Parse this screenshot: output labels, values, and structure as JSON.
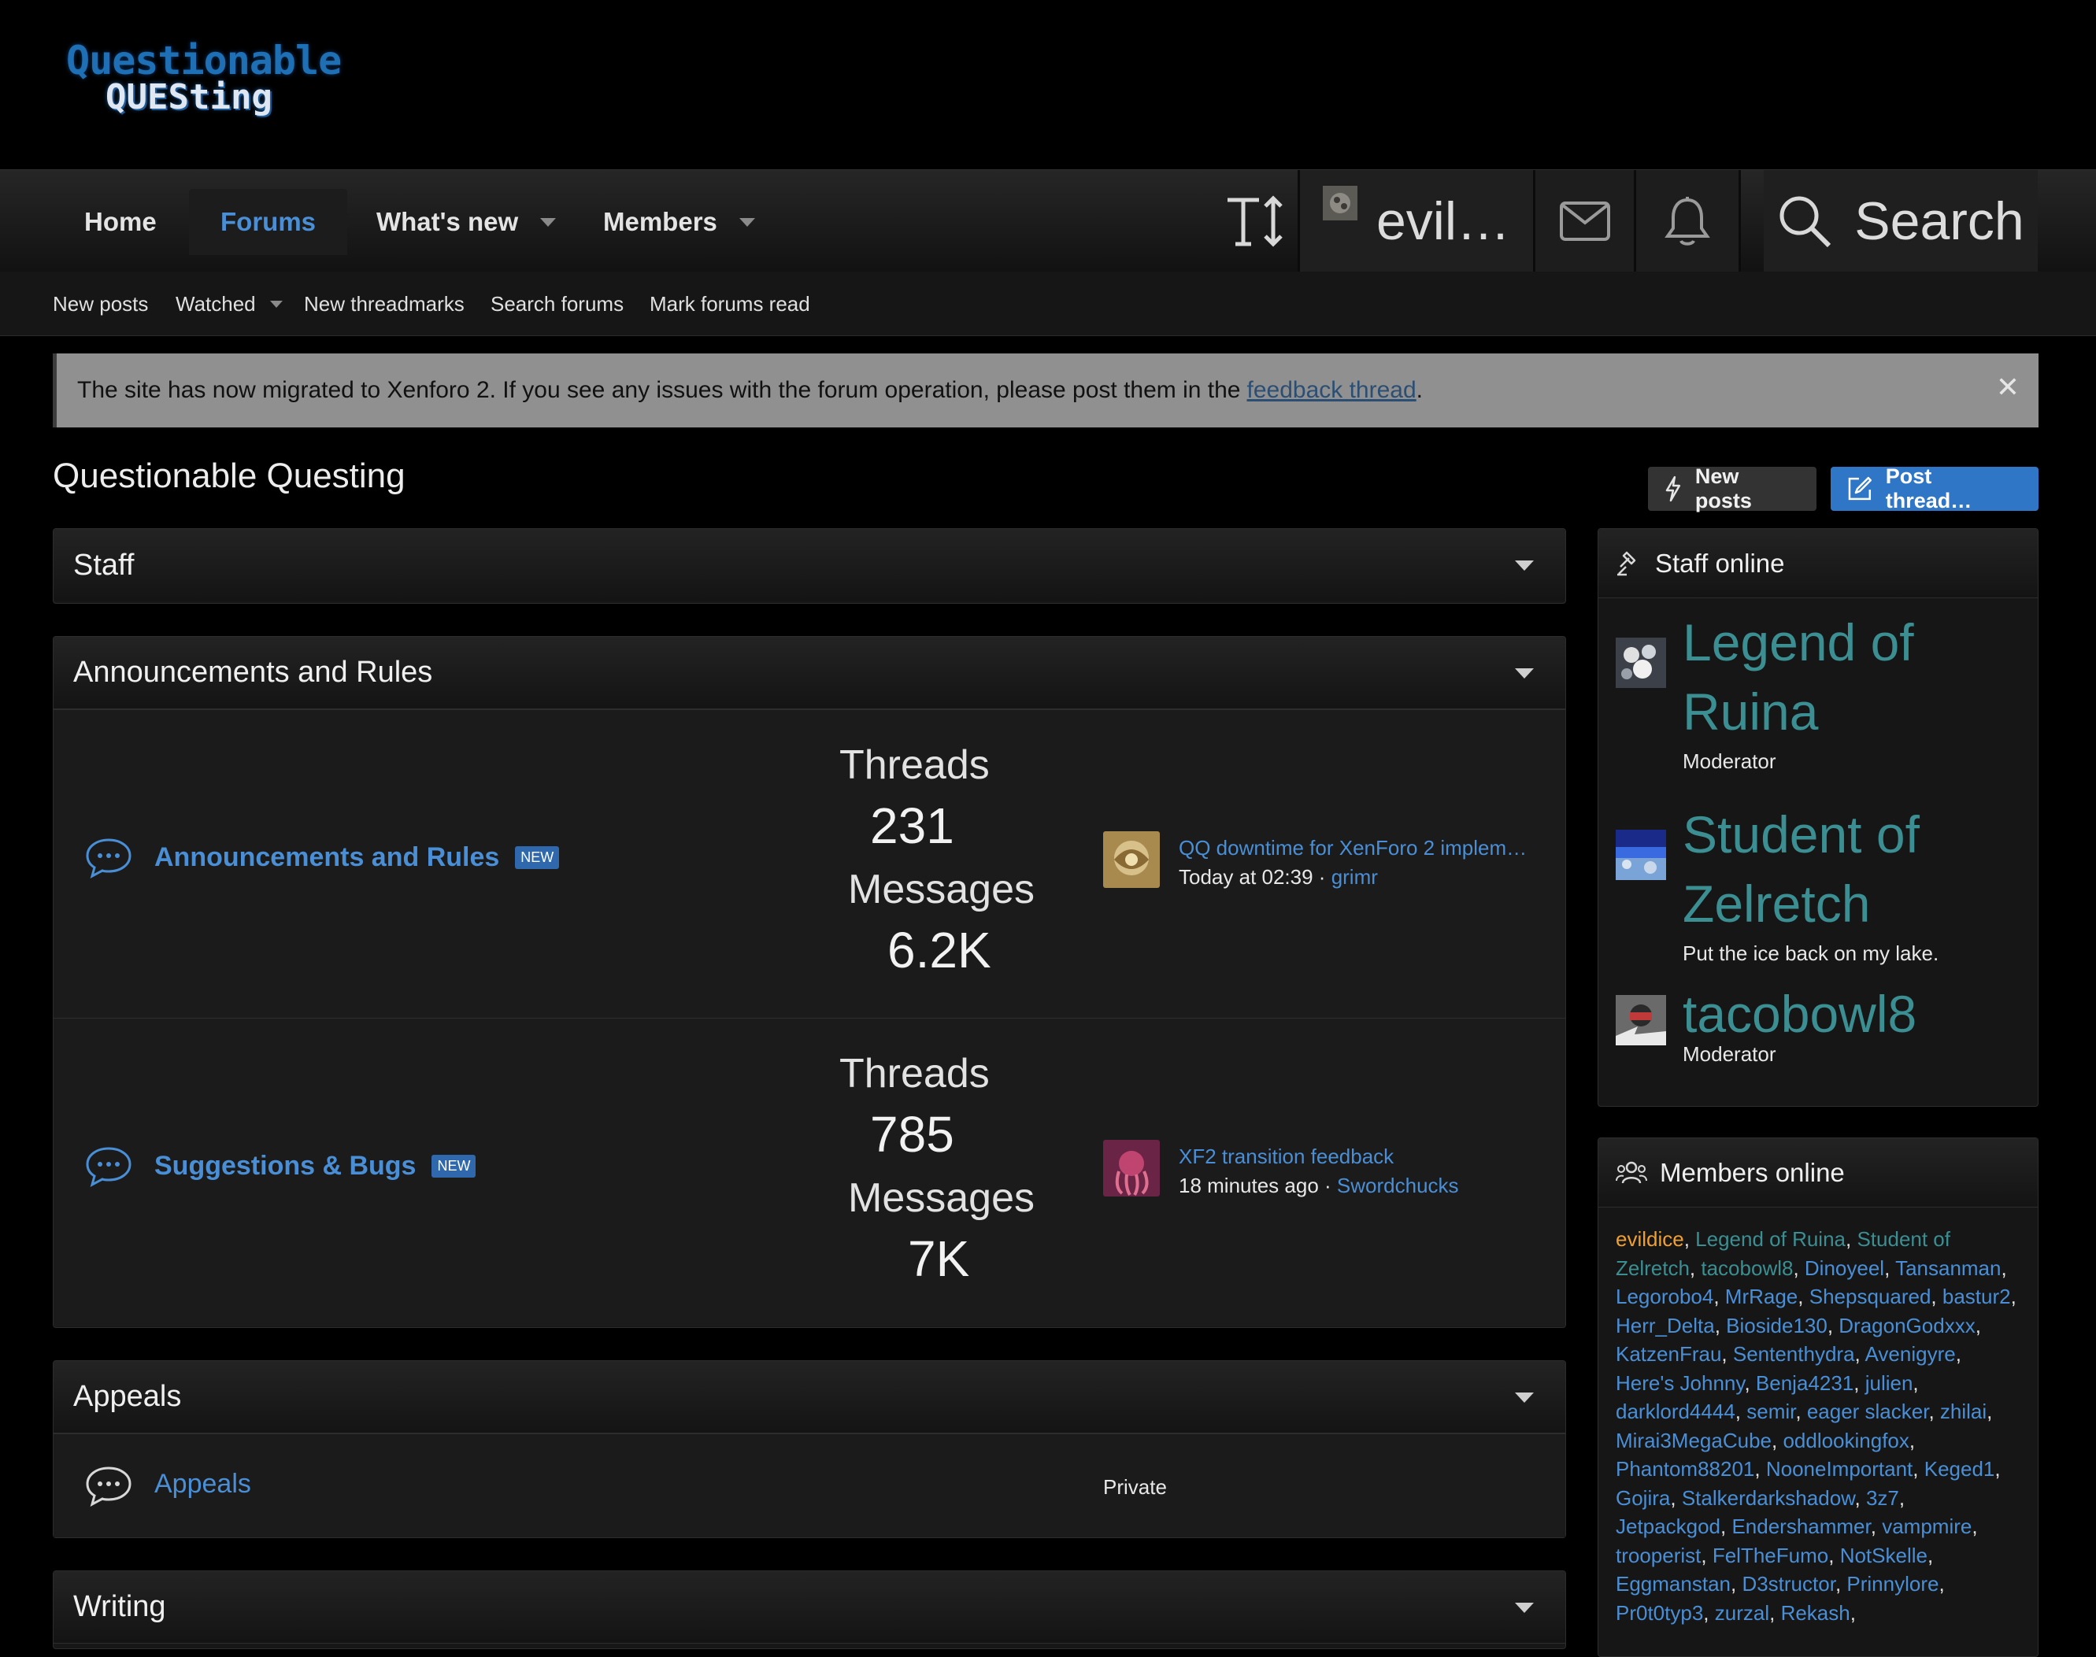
{
  "logo": {
    "line1": "Questionable",
    "line2": "QUESting"
  },
  "nav": {
    "tabs": [
      {
        "label": "Home"
      },
      {
        "label": "Forums"
      },
      {
        "label": "What's new"
      },
      {
        "label": "Members"
      }
    ],
    "username": "evil…",
    "search_label": "Search"
  },
  "subnav": {
    "items": [
      "New posts",
      "Watched",
      "New threadmarks",
      "Search forums",
      "Mark forums read"
    ]
  },
  "notice": {
    "text": "The site has now migrated to Xenforo 2. If you see any issues with the forum operation, please post them in the",
    "link": "feedback thread",
    "end": ".",
    "close": "✕"
  },
  "page": {
    "title": "Questionable Questing",
    "new_posts_button": "New posts",
    "post_thread_button": "Post thread…"
  },
  "categories": {
    "staff": {
      "title": "Staff"
    },
    "announcements": {
      "title": "Announcements and Rules",
      "nodes": [
        {
          "title": "Announcements and Rules",
          "badge": "NEW",
          "threads_label": "Threads",
          "threads": "231",
          "messages_label": "Messages",
          "messages": "6.2K",
          "last_title": "QQ downtime for XenForo 2 implem…",
          "last_time": "Today at 02:39",
          "last_sep": " · ",
          "last_user": "grimr"
        },
        {
          "title": "Suggestions & Bugs",
          "badge": "NEW",
          "threads_label": "Threads",
          "threads": "785",
          "messages_label": "Messages",
          "messages": "7K",
          "last_title": "XF2 transition feedback",
          "last_time": "18 minutes ago",
          "last_sep": " · ",
          "last_user": "Swordchucks"
        }
      ]
    },
    "appeals": {
      "title": "Appeals",
      "node": {
        "title": "Appeals",
        "status": "Private"
      }
    },
    "writing": {
      "title": "Writing"
    }
  },
  "sidebar": {
    "staff_online": {
      "title": "Staff online",
      "members": [
        {
          "name": "Legend of Ruina",
          "role": "Moderator"
        },
        {
          "name": "Student of Zelretch",
          "role": "Put the ice back on my lake."
        },
        {
          "name": "tacobowl8",
          "role": "Moderator"
        }
      ]
    },
    "members_online": {
      "title": "Members online",
      "names": [
        "evildice",
        "Legend of Ruina",
        "Student of Zelretch",
        "tacobowl8",
        "Dinoyeel",
        "Tansanman",
        "Legorobo4",
        "MrRage",
        "Shepsquared",
        "bastur2",
        "Herr_Delta",
        "Bioside130",
        "DragonGodxxx",
        "KatzenFrau",
        "Sententhydra",
        "Avenigyre",
        "Here's Johnny",
        "Benja4231",
        "julien",
        "darklord4444",
        "semir",
        "eager slacker",
        "zhilai",
        "Mirai3MegaCube",
        "oddlookingfox",
        "Phantom88201",
        "NooneImportant",
        "Keged1",
        "Gojira",
        "Stalkerdarkshadow",
        "3z7",
        "Jetpackgod",
        "Endershammer",
        "vampmire",
        "trooperist",
        "FelTheFumo",
        "NotSkelle",
        "Eggmanstan",
        "D3structor",
        "Prinnylore",
        "Pr0t0typ3",
        "zurzal",
        "Rekash"
      ]
    }
  },
  "colors": {
    "accent": "#4a8fd6",
    "staff_name": "#3b8f92",
    "current_user": "#f0a030",
    "primary_button": "#2f77c6"
  }
}
